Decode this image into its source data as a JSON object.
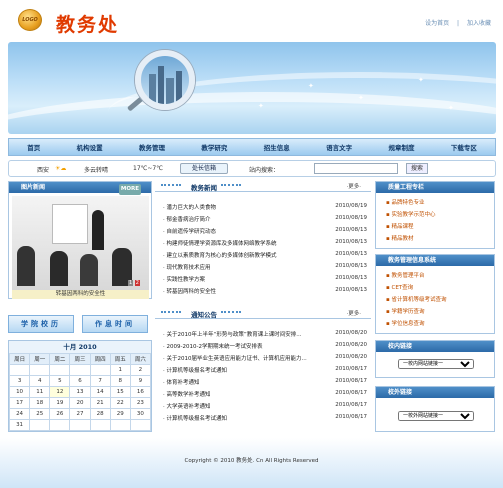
{
  "header": {
    "logo_text": "LOGO",
    "title": "教务处",
    "links": [
      "设为首页",
      "加入收藏"
    ]
  },
  "nav": [
    "首页",
    "机构设置",
    "教务管理",
    "教学研究",
    "招生信息",
    "语言文字",
    "规章制度",
    "下载专区"
  ],
  "weather": {
    "city": "西安",
    "desc": "多云转晴",
    "temp": "17℃~7℃"
  },
  "chief_mailbox": "处长信箱",
  "search": {
    "label": "站内搜索：",
    "button": "搜索"
  },
  "photo_news": {
    "title": "图片新闻",
    "more": "MORE",
    "caption": "转基因两科的安全性",
    "pager": [
      "1",
      "2"
    ]
  },
  "edu_news": {
    "title": "教务新闻",
    "more": "·更多·",
    "items": [
      {
        "t": "潘力巨大的人类食物",
        "d": "2010/08/19"
      },
      {
        "t": "郁金香病治疗简介",
        "d": "2010/08/19"
      },
      {
        "t": "自前遗传学研究动态",
        "d": "2010/08/13"
      },
      {
        "t": "构建师徒情理学资源库及多媒体网络教学系统",
        "d": "2010/08/13"
      },
      {
        "t": "建立以素质教育为核心的多媒体创新教学模式",
        "d": "2010/08/13"
      },
      {
        "t": "现代教育技术应用",
        "d": "2010/08/13"
      },
      {
        "t": "实践性教学方案",
        "d": "2010/08/13"
      },
      {
        "t": "转基因两科的安全性",
        "d": "2010/08/13"
      }
    ]
  },
  "notices": {
    "title": "通知公告",
    "more": "·更多·",
    "items": [
      {
        "t": "关于2010年上半年“形势与政策”教育课上课时间安排...",
        "d": "2010/08/20"
      },
      {
        "t": "2009-2010-2学期期末统一考试安排表",
        "d": "2010/08/20"
      },
      {
        "t": "关于2010届毕业生英语应用能力证书、计算机应用能力...",
        "d": "2010/08/20"
      },
      {
        "t": "计算机等级报名考试通知",
        "d": "2010/08/17"
      },
      {
        "t": "体育补考通知",
        "d": "2010/08/17"
      },
      {
        "t": "高等数学补考通知",
        "d": "2010/08/17"
      },
      {
        "t": "大学英语补考通知",
        "d": "2010/08/17"
      },
      {
        "t": "计算机等级报名考试通知",
        "d": "2010/08/17"
      }
    ]
  },
  "quick_buttons": [
    "学院校历",
    "作息时间"
  ],
  "calendar": {
    "month": "十月 2010",
    "weekdays": [
      "周日",
      "周一",
      "周二",
      "周三",
      "周四",
      "周五",
      "周六"
    ],
    "weeks": [
      [
        "",
        "",
        "",
        "",
        "",
        "1",
        "2"
      ],
      [
        "3",
        "4",
        "5",
        "6",
        "7",
        "8",
        "9"
      ],
      [
        "10",
        "11",
        "12",
        "13",
        "14",
        "15",
        "16"
      ],
      [
        "17",
        "18",
        "19",
        "20",
        "21",
        "22",
        "23"
      ],
      [
        "24",
        "25",
        "26",
        "27",
        "28",
        "29",
        "30"
      ],
      [
        "31",
        "",
        "",
        "",
        "",
        "",
        ""
      ]
    ],
    "today": "12"
  },
  "quality": {
    "title": "质量工程专栏",
    "items": [
      "品牌特色专业",
      "实验教学示范中心",
      "精品课程",
      "精品教材"
    ]
  },
  "system": {
    "title": "教务管理信息系统",
    "items": [
      "教务管理平台",
      "CET查询",
      "省计算机等级考试查询",
      "学籍学历查询",
      "学位信息查询"
    ]
  },
  "campus_links": {
    "title": "校内链接",
    "select": "一校内网站链接一"
  },
  "external_links": {
    "title": "校外链接",
    "select": "一校外网站链接一"
  },
  "footer": "Copyright © 2010 教务处. Cn All Rights Reserved"
}
